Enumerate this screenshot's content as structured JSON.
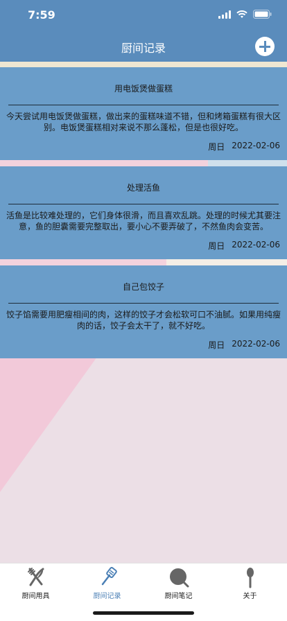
{
  "status": {
    "time": "7:59"
  },
  "header": {
    "title": "厨间记录"
  },
  "records": [
    {
      "title": "用电饭煲做蛋糕",
      "content": "今天尝试用电饭煲做蛋糕，做出来的蛋糕味道不错，但和烤箱蛋糕有很大区别。电饭煲蛋糕相对来说不那么蓬松，但是也很好吃。",
      "weekday": "周日",
      "date": "2022-02-06"
    },
    {
      "title": "处理活鱼",
      "content": "活鱼是比较难处理的，它们身体很滑，而且喜欢乱跳。处理的时候尤其要注意，鱼的胆囊需要完整取出，要小心不要弄破了，不然鱼肉会变苦。",
      "weekday": "周日",
      "date": "2022-02-06"
    },
    {
      "title": "自己包饺子",
      "content": "饺子馅需要用肥瘦相间的肉，这样的饺子才会松软可口不油腻。如果用纯瘦肉的话，饺子会太干了，就不好吃。",
      "weekday": "周日",
      "date": "2022-02-06"
    }
  ],
  "tabs": [
    {
      "label": "厨间用具",
      "icon": "fork-knife-icon",
      "active": false
    },
    {
      "label": "厨间记录",
      "icon": "spatula-icon",
      "active": true
    },
    {
      "label": "厨间笔记",
      "icon": "magnifier-icon",
      "active": false
    },
    {
      "label": "关于",
      "icon": "spoon-icon",
      "active": false
    }
  ],
  "colors": {
    "nav": "#5a8cbc",
    "card": "#6a9dc9",
    "active_tab": "#4a7fb5",
    "background_pink": "#f2c9d9",
    "background_light": "#ecdfe6"
  }
}
